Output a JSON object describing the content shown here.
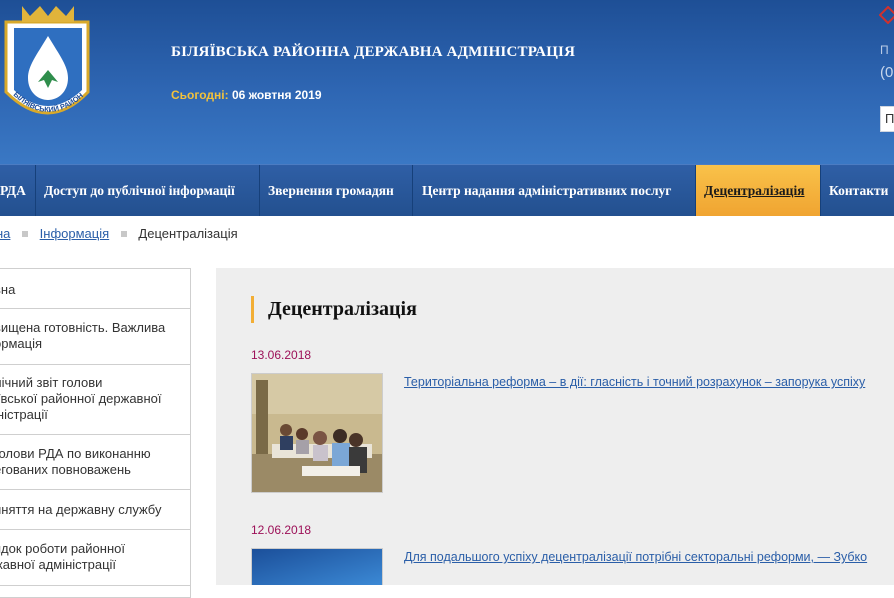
{
  "header": {
    "title": "БІЛЯЇВСЬКА РАЙОННА ДЕРЖАВНА АДМІНІСТРАЦІЯ",
    "today_label": "Сьогодні:",
    "today_value": "06 жовтня 2019",
    "crest_text": "БІЛЯЇВСЬКИЙ РАЙОН",
    "right_partial_text": "П",
    "right_partial_phone": "(0",
    "search_partial": "П"
  },
  "nav": {
    "items": [
      {
        "label": "РДА"
      },
      {
        "label": "Доступ до публічної інформації"
      },
      {
        "label": "Звернення громадян"
      },
      {
        "label": "Центр надання адміністративних послуг"
      },
      {
        "label": "Децентралізація"
      },
      {
        "label": "Контакти"
      }
    ],
    "active": "Децентралізація"
  },
  "breadcrumb": {
    "items": [
      "на",
      "Інформація",
      "Децентралізація"
    ]
  },
  "sidebar": {
    "items": [
      {
        "label": "вна"
      },
      {
        "label": "вищена готовність. Важлива\nормація"
      },
      {
        "label": "лічний звіт голови\nіївської районної державної\nіністрації"
      },
      {
        "label": "голови РДА по виконанню\nегованих повноважень"
      },
      {
        "label": "йняття на державну службу"
      },
      {
        "label": "ядок роботи районної\nжавної адміністрації"
      }
    ]
  },
  "main": {
    "title": "Децентралізація",
    "news": [
      {
        "date": "13.06.2018",
        "title": "Територіальна реформа – в дії: гласність і точний розрахунок – запорука успіху"
      },
      {
        "date": "12.06.2018",
        "title": "Для подальшого успіху децентралізації потрібні секторальні реформи, — Зубко"
      }
    ]
  },
  "colors": {
    "header_blue": "#2e66b3",
    "nav_active": "#f0a431",
    "link": "#2a5ea8",
    "date": "#9c1058",
    "title_accent": "#f2ae35"
  }
}
